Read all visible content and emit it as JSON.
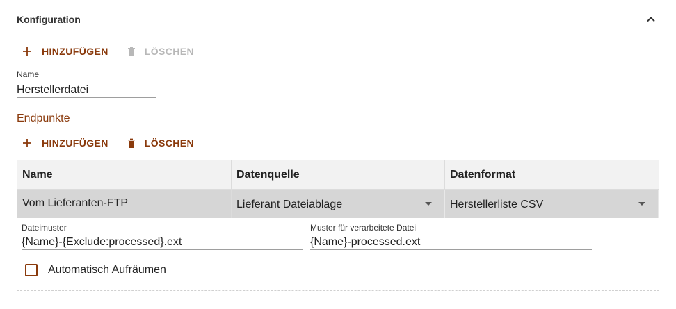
{
  "panel": {
    "title": "Konfiguration",
    "expand_icon": "chevron-up-icon"
  },
  "top_toolbar": {
    "add_label": "HINZUFÜGEN",
    "delete_label": "LÖSCHEN",
    "delete_disabled": true,
    "add_icon": "plus-icon",
    "delete_icon": "trash-icon"
  },
  "name_field": {
    "label": "Name",
    "value": "Herstellerdatei"
  },
  "endpoints": {
    "title": "Endpunkte",
    "toolbar": {
      "add_label": "HINZUFÜGEN",
      "delete_label": "LÖSCHEN",
      "delete_disabled": false
    },
    "columns": [
      "Name",
      "Datenquelle",
      "Datenformat"
    ],
    "rows": [
      {
        "name": "Vom Lieferanten-FTP",
        "datenquelle": "Lieferant Dateiablage",
        "datenformat": "Herstellerliste CSV"
      }
    ],
    "detail": {
      "dateimuster": {
        "label": "Dateimuster",
        "value": "{Name}-{Exclude:processed}.ext"
      },
      "muster_verarbeitet": {
        "label": "Muster für verarbeitete Datei",
        "value": "{Name}-processed.ext"
      },
      "auto_cleanup": {
        "label": "Automatisch Aufräumen",
        "checked": false
      }
    }
  },
  "colors": {
    "accent": "#8a3a0c",
    "disabled": "#b8b8b8",
    "selected_row": "#d6d6d6",
    "header_bg": "#f2f2f2"
  }
}
